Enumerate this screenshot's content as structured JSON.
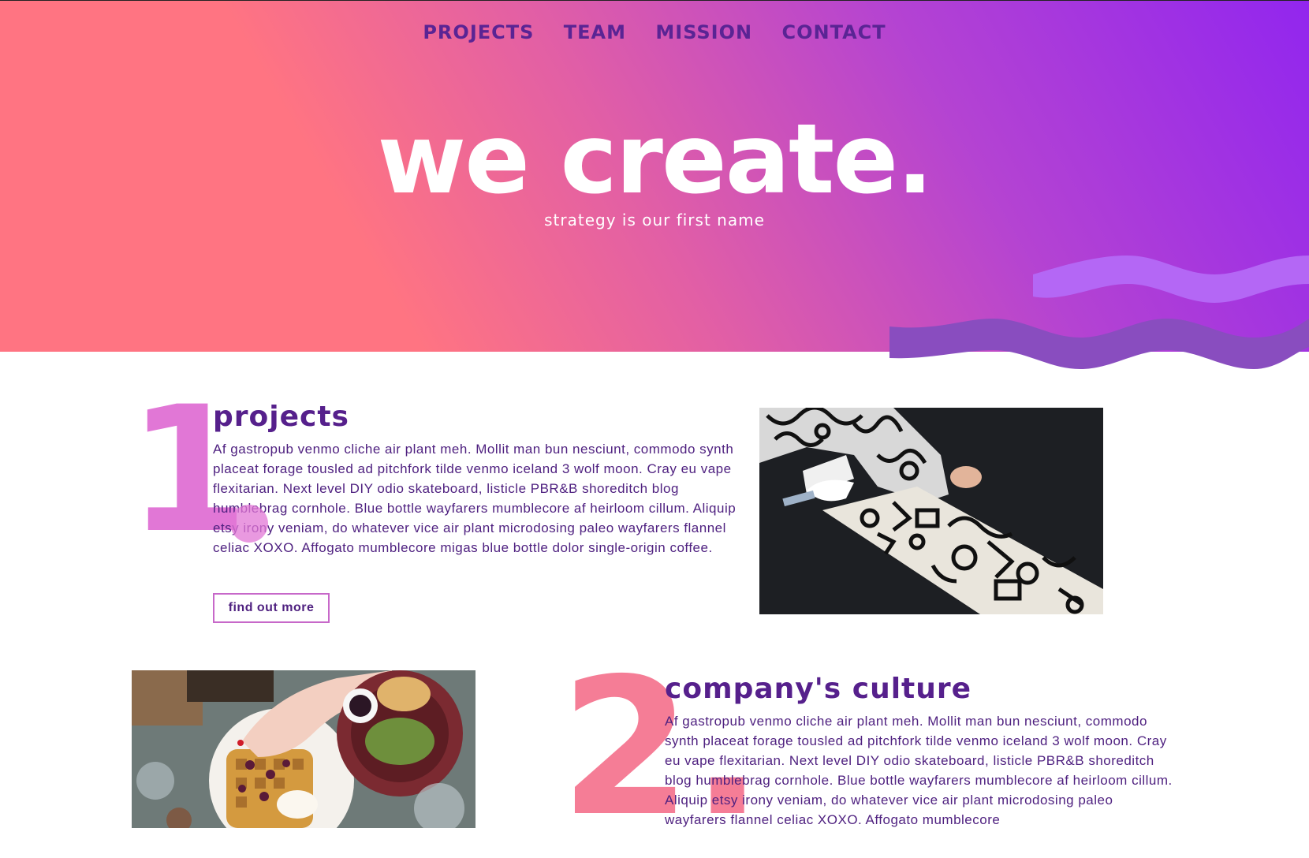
{
  "nav": {
    "items": [
      "PROJECTS",
      "TEAM",
      "MISSION",
      "CONTACT"
    ]
  },
  "hero": {
    "title": "we create.",
    "subtitle": "strategy is our first name"
  },
  "sections": [
    {
      "number": "1",
      "title": "projects",
      "body": "Af gastropub venmo cliche air plant meh. Mollit man bun nesciunt, commodo synth placeat forage tousled ad pitchfork tilde venmo iceland 3 wolf moon. Cray eu vape flexitarian. Next level DIY odio skateboard, listicle PBR&B shoreditch blog humblebrag cornhole. Blue bottle wayfarers mumblecore af heirloom cillum. Aliquip etsy irony veniam, do whatever vice air plant microdosing paleo wayfarers flannel celiac XOXO. Affogato mumblecore migas blue bottle dolor single-origin coffee.",
      "button": "find out more"
    },
    {
      "number": "2.",
      "title": "company's culture",
      "body": "Af gastropub venmo cliche air plant meh. Mollit man bun nesciunt, commodo synth placeat forage tousled ad pitchfork tilde venmo iceland 3 wolf moon. Cray eu vape flexitarian. Next level DIY odio skateboard, listicle PBR&B shoreditch blog humblebrag cornhole. Blue bottle wayfarers mumblecore af heirloom cillum. Aliquip etsy irony veniam, do whatever vice air plant microdosing paleo wayfarers flannel celiac XOXO. Affogato mumblecore"
    }
  ],
  "colors": {
    "gradient_start": "#ff7482",
    "gradient_end": "#9226ee",
    "nav_text": "#5a2494",
    "heading": "#56208c",
    "body_text": "#4f2180",
    "number_one": "#e177d6",
    "number_two": "#f57d96",
    "wave_light": "#b467f5",
    "wave_dark": "#894dbf"
  }
}
